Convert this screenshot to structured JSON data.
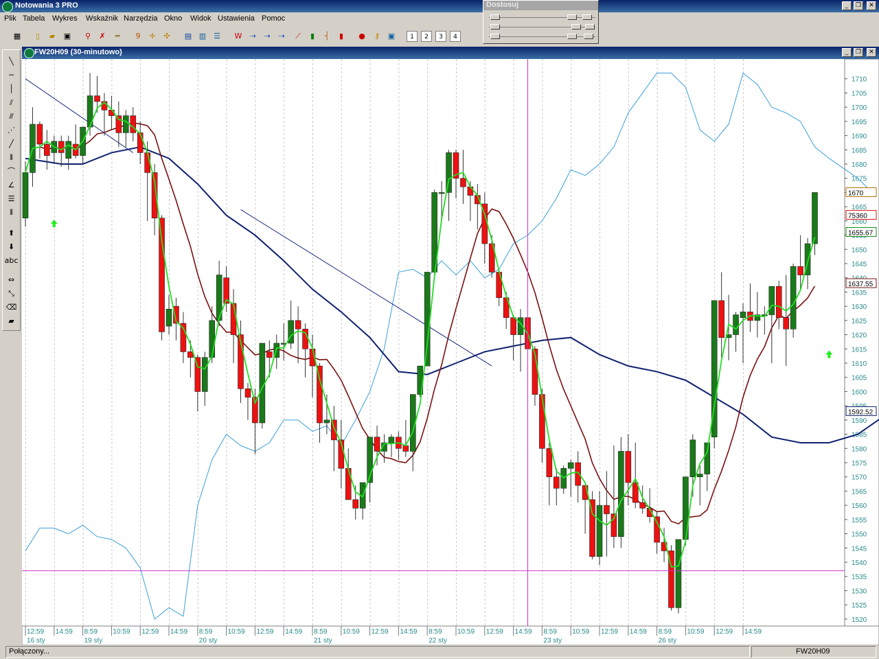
{
  "app": {
    "title": "Notowania 3 PRO"
  },
  "menu": [
    "Plik",
    "Tabela",
    "Wykres",
    "Wskaźnik",
    "Narzędzia",
    "Okno",
    "Widok",
    "Ustawienia",
    "Pomoc"
  ],
  "toolbar": {
    "period_buttons": [
      "1",
      "2",
      "3",
      "4"
    ]
  },
  "adjust_panel": {
    "title": "Dostosuj"
  },
  "left_tools": {
    "text_tool": "abc"
  },
  "chart_window": {
    "title": "FW20H09 (30-minutowo)"
  },
  "status": {
    "connection": "Połączony...",
    "symbol": "FW20H09"
  },
  "colors": {
    "up": "#1a7a1a",
    "down": "#ee1111",
    "fast_ma": "#22dd22",
    "mid_ma": "#7a1010",
    "slow_ma": "#102070",
    "cyan_line": "#3aa0d8",
    "crosshair": "#cc33cc",
    "axis_text": "#2a8a8a"
  },
  "chart_data": {
    "type": "candlestick",
    "ylim": [
      1519,
      1715
    ],
    "y_ticks": [
      1520,
      1525,
      1530,
      1535,
      1540,
      1545,
      1550,
      1555,
      1560,
      1565,
      1570,
      1575,
      1580,
      1585,
      1590,
      1595,
      1600,
      1605,
      1610,
      1615,
      1620,
      1625,
      1630,
      1635,
      1640,
      1645,
      1650,
      1655,
      1660,
      1665,
      1670,
      1675,
      1680,
      1685,
      1690,
      1695,
      1700,
      1705,
      1710
    ],
    "x_time_labels": [
      {
        "i": 0,
        "t": "12:59"
      },
      {
        "i": 4,
        "t": "14:59"
      },
      {
        "i": 8,
        "t": "8:59"
      },
      {
        "i": 12,
        "t": "10:59"
      },
      {
        "i": 16,
        "t": "12:59"
      },
      {
        "i": 20,
        "t": "14:59"
      },
      {
        "i": 24,
        "t": "8:59"
      },
      {
        "i": 28,
        "t": "10:59"
      },
      {
        "i": 32,
        "t": "12:59"
      },
      {
        "i": 36,
        "t": "14:59"
      },
      {
        "i": 40,
        "t": "8:59"
      },
      {
        "i": 44,
        "t": "10:59"
      },
      {
        "i": 48,
        "t": "12:59"
      },
      {
        "i": 52,
        "t": "14:59"
      },
      {
        "i": 56,
        "t": "8:59"
      },
      {
        "i": 60,
        "t": "10:59"
      },
      {
        "i": 64,
        "t": "12:59"
      },
      {
        "i": 68,
        "t": "14:59"
      },
      {
        "i": 72,
        "t": "8:59"
      },
      {
        "i": 76,
        "t": "10:59"
      },
      {
        "i": 80,
        "t": "12:59"
      },
      {
        "i": 84,
        "t": "14:59"
      },
      {
        "i": 88,
        "t": "8:59"
      },
      {
        "i": 92,
        "t": "10:59"
      },
      {
        "i": 96,
        "t": "12:59"
      },
      {
        "i": 100,
        "t": "14:59"
      }
    ],
    "x_date_labels": [
      {
        "i": 0,
        "t": "16 sty"
      },
      {
        "i": 8,
        "t": "19 sty"
      },
      {
        "i": 24,
        "t": "20 sty"
      },
      {
        "i": 40,
        "t": "21 sty"
      },
      {
        "i": 56,
        "t": "22 sty"
      },
      {
        "i": 72,
        "t": "23 sty"
      },
      {
        "i": 88,
        "t": "26 sty"
      }
    ],
    "candles": [
      [
        1661,
        1681,
        1658,
        1677
      ],
      [
        1677,
        1700,
        1672,
        1694
      ],
      [
        1694,
        1695,
        1682,
        1687
      ],
      [
        1687,
        1692,
        1678,
        1683
      ],
      [
        1684,
        1690,
        1680,
        1688
      ],
      [
        1688,
        1690,
        1679,
        1684
      ],
      [
        1682,
        1690,
        1678,
        1688
      ],
      [
        1687,
        1694,
        1682,
        1683
      ],
      [
        1683,
        1693,
        1680,
        1693
      ],
      [
        1693,
        1712,
        1690,
        1704
      ],
      [
        1704,
        1711,
        1698,
        1702
      ],
      [
        1702,
        1705,
        1690,
        1699
      ],
      [
        1699,
        1704,
        1692,
        1697
      ],
      [
        1697,
        1702,
        1686,
        1691
      ],
      [
        1691,
        1699,
        1686,
        1697
      ],
      [
        1697,
        1700,
        1688,
        1691
      ],
      [
        1691,
        1695,
        1680,
        1684
      ],
      [
        1684,
        1688,
        1660,
        1677
      ],
      [
        1677,
        1680,
        1655,
        1661
      ],
      [
        1661,
        1662,
        1618,
        1621
      ],
      [
        1623,
        1634,
        1620,
        1629
      ],
      [
        1630,
        1633,
        1618,
        1624
      ],
      [
        1624,
        1628,
        1610,
        1614
      ],
      [
        1614,
        1618,
        1605,
        1612
      ],
      [
        1612,
        1613,
        1593,
        1600
      ],
      [
        1600,
        1614,
        1595,
        1612
      ],
      [
        1612,
        1630,
        1610,
        1625
      ],
      [
        1625,
        1646,
        1623,
        1641
      ],
      [
        1640,
        1644,
        1628,
        1631
      ],
      [
        1631,
        1636,
        1610,
        1620
      ],
      [
        1620,
        1625,
        1596,
        1601
      ],
      [
        1601,
        1603,
        1590,
        1598
      ],
      [
        1598,
        1601,
        1578,
        1589
      ],
      [
        1589,
        1614,
        1587,
        1617
      ],
      [
        1614,
        1618,
        1605,
        1612
      ],
      [
        1612,
        1620,
        1608,
        1617
      ],
      [
        1617,
        1624,
        1611,
        1617
      ],
      [
        1617,
        1632,
        1615,
        1625
      ],
      [
        1625,
        1630,
        1610,
        1622
      ],
      [
        1622,
        1624,
        1605,
        1615
      ],
      [
        1615,
        1620,
        1598,
        1609
      ],
      [
        1609,
        1610,
        1582,
        1589
      ],
      [
        1589,
        1599,
        1585,
        1590
      ],
      [
        1590,
        1595,
        1572,
        1583
      ],
      [
        1583,
        1590,
        1566,
        1573
      ],
      [
        1573,
        1580,
        1562,
        1562
      ],
      [
        1562,
        1567,
        1555,
        1559
      ],
      [
        1559,
        1565,
        1555,
        1568
      ],
      [
        1568,
        1575,
        1561,
        1584
      ],
      [
        1584,
        1588,
        1574,
        1579
      ],
      [
        1579,
        1585,
        1575,
        1582
      ],
      [
        1582,
        1585,
        1577,
        1584
      ],
      [
        1584,
        1586,
        1576,
        1580
      ],
      [
        1581,
        1590,
        1577,
        1579
      ],
      [
        1579,
        1581,
        1572,
        1599
      ],
      [
        1599,
        1605,
        1598,
        1609
      ],
      [
        1609,
        1642,
        1609,
        1642
      ],
      [
        1642,
        1671,
        1640,
        1670
      ],
      [
        1670,
        1674,
        1660,
        1670
      ],
      [
        1670,
        1685,
        1660,
        1684
      ],
      [
        1684,
        1685,
        1668,
        1675
      ],
      [
        1675,
        1685,
        1666,
        1672
      ],
      [
        1672,
        1674,
        1660,
        1669
      ],
      [
        1669,
        1673,
        1657,
        1666
      ],
      [
        1666,
        1670,
        1645,
        1652
      ],
      [
        1652,
        1655,
        1640,
        1642
      ],
      [
        1642,
        1643,
        1630,
        1633
      ],
      [
        1633,
        1635,
        1622,
        1626
      ],
      [
        1626,
        1627,
        1611,
        1620
      ],
      [
        1620,
        1629,
        1607,
        1626
      ],
      [
        1626,
        1627,
        1615,
        1615
      ],
      [
        1615,
        1616,
        1595,
        1599
      ],
      [
        1599,
        1601,
        1575,
        1580
      ],
      [
        1580,
        1582,
        1560,
        1570
      ],
      [
        1570,
        1573,
        1560,
        1566
      ],
      [
        1566,
        1574,
        1564,
        1573
      ],
      [
        1573,
        1576,
        1563,
        1575
      ],
      [
        1575,
        1579,
        1561,
        1567
      ],
      [
        1567,
        1567,
        1550,
        1562
      ],
      [
        1562,
        1565,
        1541,
        1542
      ],
      [
        1542,
        1565,
        1539,
        1560
      ],
      [
        1560,
        1572,
        1542,
        1557
      ],
      [
        1557,
        1581,
        1545,
        1549
      ],
      [
        1549,
        1584,
        1545,
        1579
      ],
      [
        1579,
        1585,
        1560,
        1568
      ],
      [
        1568,
        1582,
        1559,
        1561
      ],
      [
        1561,
        1567,
        1557,
        1559
      ],
      [
        1559,
        1566,
        1554,
        1556
      ],
      [
        1556,
        1558,
        1543,
        1547
      ],
      [
        1547,
        1552,
        1540,
        1544
      ],
      [
        1544,
        1546,
        1523,
        1524
      ],
      [
        1524,
        1548,
        1522,
        1548
      ],
      [
        1548,
        1570,
        1546,
        1570
      ],
      [
        1570,
        1585,
        1563,
        1583
      ],
      [
        1570,
        1574,
        1560,
        1571
      ],
      [
        1571,
        1577,
        1565,
        1582
      ],
      [
        1584,
        1632,
        1580,
        1632
      ],
      [
        1632,
        1642,
        1612,
        1619
      ],
      [
        1619,
        1634,
        1611,
        1620
      ],
      [
        1620,
        1628,
        1614,
        1627
      ],
      [
        1626,
        1631,
        1610,
        1628
      ],
      [
        1628,
        1638,
        1621,
        1625
      ],
      [
        1625,
        1635,
        1619,
        1627
      ],
      [
        1627,
        1630,
        1620,
        1627
      ],
      [
        1627,
        1637,
        1610,
        1637
      ],
      [
        1637,
        1639,
        1622,
        1626
      ],
      [
        1626,
        1641,
        1609,
        1622
      ],
      [
        1622,
        1645,
        1619,
        1644
      ],
      [
        1644,
        1655,
        1636,
        1641
      ],
      [
        1641,
        1654,
        1636,
        1652
      ],
      [
        1652,
        1670,
        1648,
        1670
      ]
    ],
    "slow_ma": [
      [
        0,
        1682
      ],
      [
        5,
        1680
      ],
      [
        8,
        1680
      ],
      [
        12,
        1684
      ],
      [
        16,
        1686
      ],
      [
        20,
        1682
      ],
      [
        24,
        1673
      ],
      [
        28,
        1662
      ],
      [
        32,
        1655
      ],
      [
        36,
        1646
      ],
      [
        40,
        1636
      ],
      [
        44,
        1628
      ],
      [
        48,
        1619
      ],
      [
        52,
        1607
      ],
      [
        56,
        1606
      ],
      [
        60,
        1610
      ],
      [
        64,
        1614
      ],
      [
        68,
        1616
      ],
      [
        72,
        1618
      ],
      [
        76,
        1619
      ],
      [
        80,
        1613
      ],
      [
        84,
        1609
      ],
      [
        88,
        1607
      ],
      [
        92,
        1604
      ],
      [
        96,
        1598
      ],
      [
        100,
        1592
      ],
      [
        104,
        1584
      ],
      [
        108,
        1582
      ],
      [
        112,
        1582
      ],
      [
        116,
        1585
      ],
      [
        120,
        1592
      ]
    ],
    "cyan_line": [
      [
        0,
        1544
      ],
      [
        2,
        1552
      ],
      [
        4,
        1552
      ],
      [
        6,
        1550
      ],
      [
        8,
        1553
      ],
      [
        10,
        1549
      ],
      [
        12,
        1548
      ],
      [
        14,
        1545
      ],
      [
        16,
        1538
      ],
      [
        18,
        1520
      ],
      [
        20,
        1524
      ],
      [
        22,
        1521
      ],
      [
        24,
        1560
      ],
      [
        26,
        1576
      ],
      [
        28,
        1585
      ],
      [
        30,
        1581
      ],
      [
        32,
        1579
      ],
      [
        34,
        1582
      ],
      [
        36,
        1590
      ],
      [
        38,
        1590
      ],
      [
        40,
        1586
      ],
      [
        42,
        1588
      ],
      [
        44,
        1581
      ],
      [
        46,
        1590
      ],
      [
        48,
        1600
      ],
      [
        50,
        1615
      ],
      [
        52,
        1642
      ],
      [
        54,
        1643
      ],
      [
        56,
        1640
      ],
      [
        58,
        1646
      ],
      [
        60,
        1641
      ],
      [
        62,
        1646
      ],
      [
        64,
        1640
      ],
      [
        66,
        1643
      ],
      [
        68,
        1652
      ],
      [
        70,
        1655
      ],
      [
        72,
        1660
      ],
      [
        74,
        1668
      ],
      [
        76,
        1678
      ],
      [
        78,
        1676
      ],
      [
        80,
        1680
      ],
      [
        82,
        1686
      ],
      [
        84,
        1698
      ],
      [
        86,
        1705
      ],
      [
        88,
        1712
      ],
      [
        90,
        1712
      ],
      [
        92,
        1707
      ],
      [
        94,
        1692
      ],
      [
        96,
        1688
      ],
      [
        98,
        1694
      ],
      [
        100,
        1712
      ],
      [
        102,
        1708
      ],
      [
        104,
        1700
      ],
      [
        106,
        1698
      ],
      [
        108,
        1695
      ],
      [
        110,
        1686
      ],
      [
        112,
        1682
      ],
      [
        116,
        1675
      ],
      [
        118,
        1670
      ]
    ],
    "trendlines": [
      {
        "from": [
          0,
          1710
        ],
        "to": [
          15,
          1684
        ]
      },
      {
        "from": [
          30,
          1664
        ],
        "to": [
          65,
          1609
        ]
      }
    ],
    "crosshair": {
      "x_index": 70,
      "y_value": 1537
    },
    "arrows": [
      {
        "i": 4,
        "y": 1659
      },
      {
        "i": 112,
        "y": 1613
      }
    ],
    "price_labels": [
      {
        "value": 1670,
        "text": "1670",
        "color": "#b07000"
      },
      {
        "value": 1662,
        "text": "75360",
        "color": "#dd1111"
      },
      {
        "value": 1656,
        "text": "1655.67",
        "color": "#118811"
      },
      {
        "value": 1638,
        "text": "1637.55",
        "color": "#7a1010"
      },
      {
        "value": 1593,
        "text": "1592.52",
        "color": "#102070"
      }
    ]
  }
}
